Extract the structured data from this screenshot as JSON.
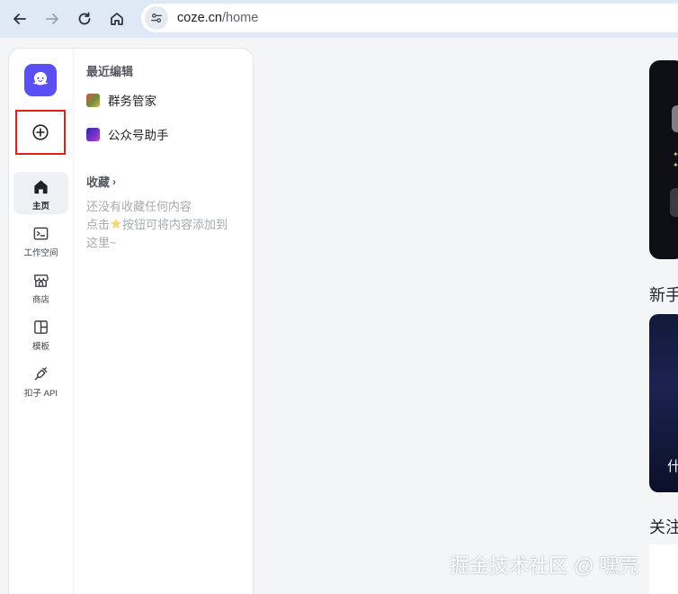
{
  "browser": {
    "url_host": "coze.cn",
    "url_path": "/home"
  },
  "sidebar": {
    "rail": [
      {
        "label": "主页",
        "icon": "home-icon",
        "active": true
      },
      {
        "label": "工作空间",
        "icon": "workspace-icon",
        "active": false
      },
      {
        "label": "商店",
        "icon": "store-icon",
        "active": false
      },
      {
        "label": "模板",
        "icon": "template-icon",
        "active": false
      },
      {
        "label": "扣子 API",
        "icon": "api-plug-icon",
        "active": false
      }
    ],
    "recent_title": "最近编辑",
    "recent_items": [
      {
        "label": "群务管家",
        "icon": "group-bot-avatar"
      },
      {
        "label": "公众号助手",
        "icon": "wechat-bot-avatar"
      }
    ],
    "favorites_title": "收藏",
    "favorites_empty_line1": "还没有收藏任何内容",
    "favorites_empty_line2a": "点击",
    "favorites_empty_line2b": "按钮可将内容添加到",
    "favorites_empty_line3": "这里~"
  },
  "main": {
    "section1_heading": "新手",
    "promo_text": "什",
    "section2_heading": "关注"
  },
  "watermark": "掘金技术社区 @ 嘿壳",
  "colors": {
    "brand": "#5a4ff3",
    "highlight_border": "#e0201c",
    "browser_bar": "#dfe8f5"
  }
}
